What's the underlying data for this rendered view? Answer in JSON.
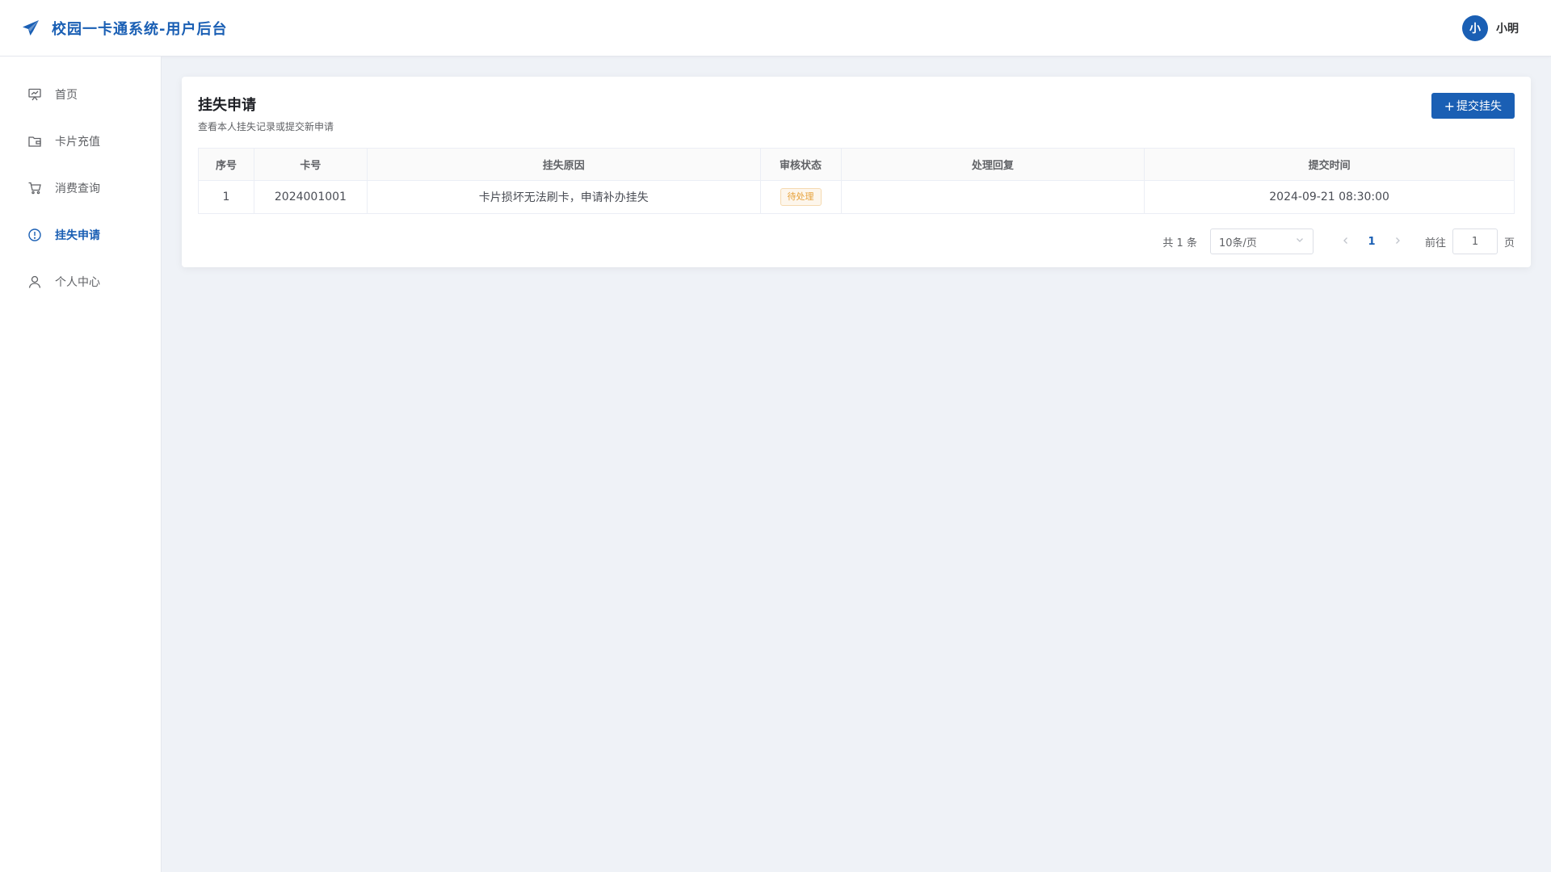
{
  "header": {
    "title": "校园一卡通系统-用户后台",
    "brand_icon": "paper-plane-icon",
    "accent": "#1a5fb4",
    "user": {
      "avatar_letter": "小",
      "name": "小明"
    }
  },
  "sidebar": {
    "items": [
      {
        "label": "首页",
        "icon": "presentation-icon",
        "active": false
      },
      {
        "label": "卡片充值",
        "icon": "wallet-icon",
        "active": false
      },
      {
        "label": "消费查询",
        "icon": "cart-icon",
        "active": false
      },
      {
        "label": "挂失申请",
        "icon": "alert-circle-icon",
        "active": true
      },
      {
        "label": "个人中心",
        "icon": "user-icon",
        "active": false
      }
    ]
  },
  "main": {
    "title": "挂失申请",
    "subtitle": "查看本人挂失记录或提交新申请",
    "submit_button": {
      "plus": "+",
      "label": "提交挂失"
    },
    "table": {
      "columns": [
        "序号",
        "卡号",
        "挂失原因",
        "审核状态",
        "处理回复",
        "提交时间"
      ],
      "rows": [
        {
          "index": "1",
          "card_no": "2024001001",
          "reason": "卡片损坏无法刷卡，申请补办挂失",
          "status": "待处理",
          "reply": "",
          "submitted_at": "2024-09-21 08:30:00"
        }
      ]
    },
    "pagination": {
      "total_text": "共 1 条",
      "page_size": "10条/页",
      "current_page": "1",
      "goto_label": "前往",
      "goto_value": "1",
      "page_unit": "页"
    }
  }
}
